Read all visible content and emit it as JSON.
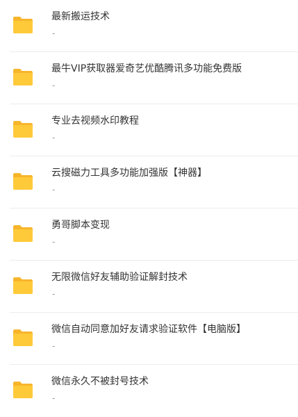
{
  "files": [
    {
      "name": "最新搬运技术",
      "meta": "-",
      "icon": "folder-icon"
    },
    {
      "name": "最牛VIP获取器爱奇艺优酷腾讯多功能免费版",
      "meta": "-",
      "icon": "folder-icon"
    },
    {
      "name": "专业去视频水印教程",
      "meta": "-",
      "icon": "folder-icon"
    },
    {
      "name": "云搜磁力工具多功能加强版【神器】",
      "meta": "-",
      "icon": "folder-icon"
    },
    {
      "name": "勇哥脚本变现",
      "meta": "-",
      "icon": "folder-icon"
    },
    {
      "name": "无限微信好友辅助验证解封技术",
      "meta": "-",
      "icon": "folder-icon"
    },
    {
      "name": "微信自动同意加好友请求验证软件【电脑版】",
      "meta": "-",
      "icon": "folder-icon"
    },
    {
      "name": "微信永久不被封号技术",
      "meta": "-",
      "icon": "folder-icon"
    }
  ],
  "colors": {
    "folder_back": "#F7B52C",
    "folder_front": "#FFCA3A",
    "divider": "#ECECEC",
    "name_text": "#333333",
    "meta_text": "#9A9A9A"
  }
}
